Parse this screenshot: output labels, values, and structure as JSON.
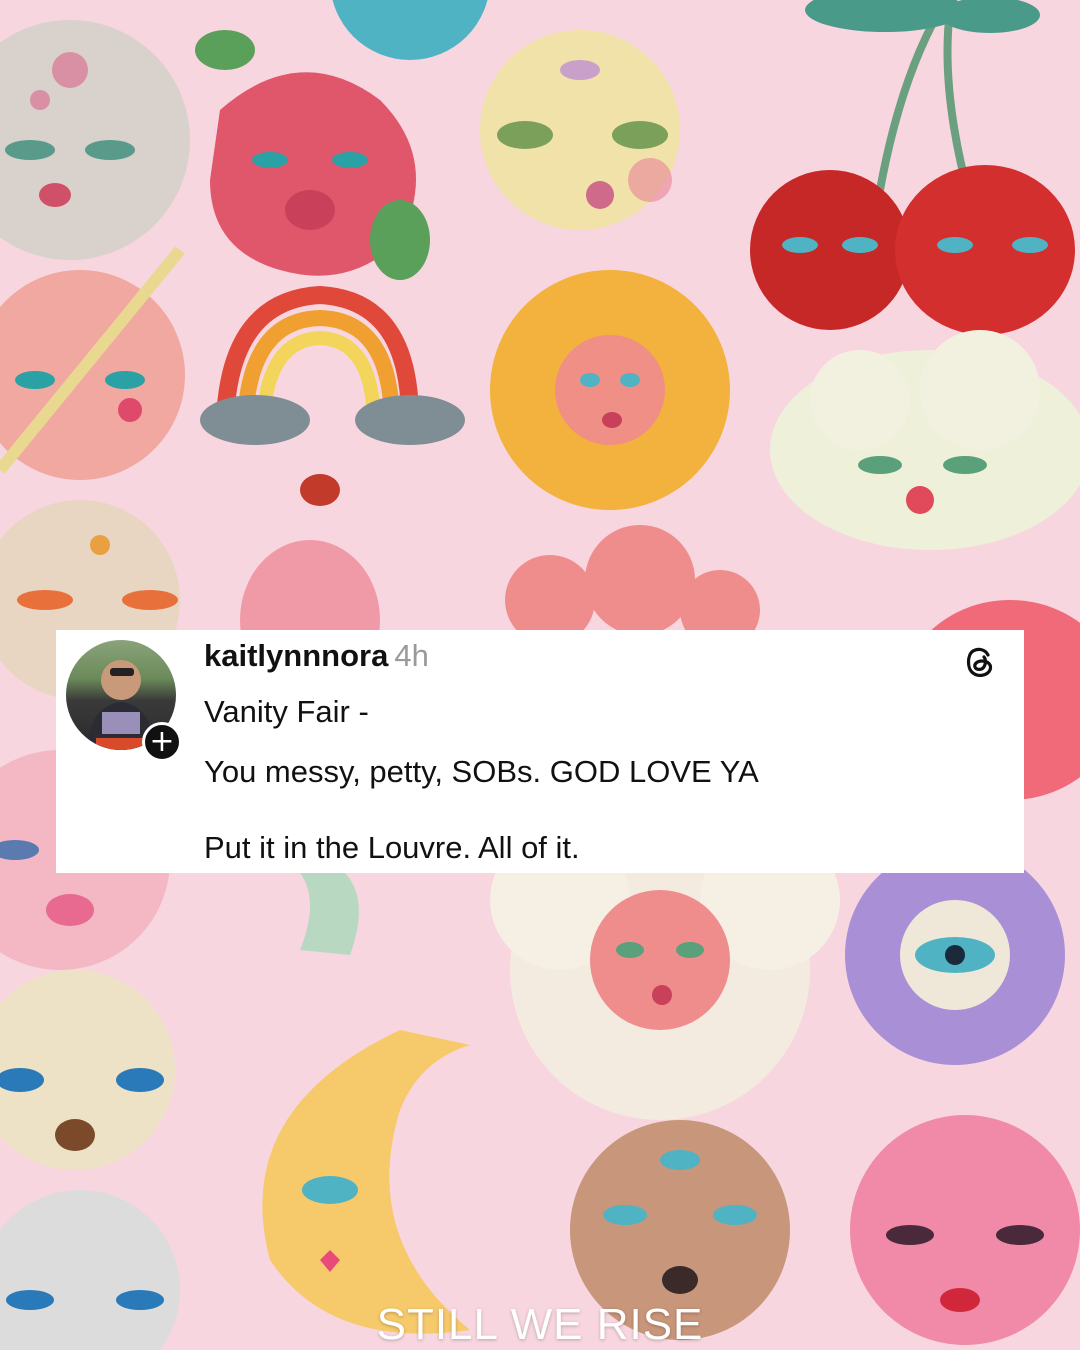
{
  "post": {
    "username": "kaitlynnnora",
    "time": "4h",
    "lines": [
      "Vanity Fair -",
      "You messy, petty, SOBs. GOD LOVE YA",
      "Put it in the Louvre. All of it."
    ],
    "follow_symbol": "+"
  },
  "watermark": "STILL WE RISE",
  "colors": {
    "background": "#f8d6df",
    "card": "#ffffff",
    "text": "#111111",
    "muted": "#9a9a9a"
  },
  "icons": {
    "threads": "threads-logo-icon",
    "follow": "plus-icon"
  }
}
